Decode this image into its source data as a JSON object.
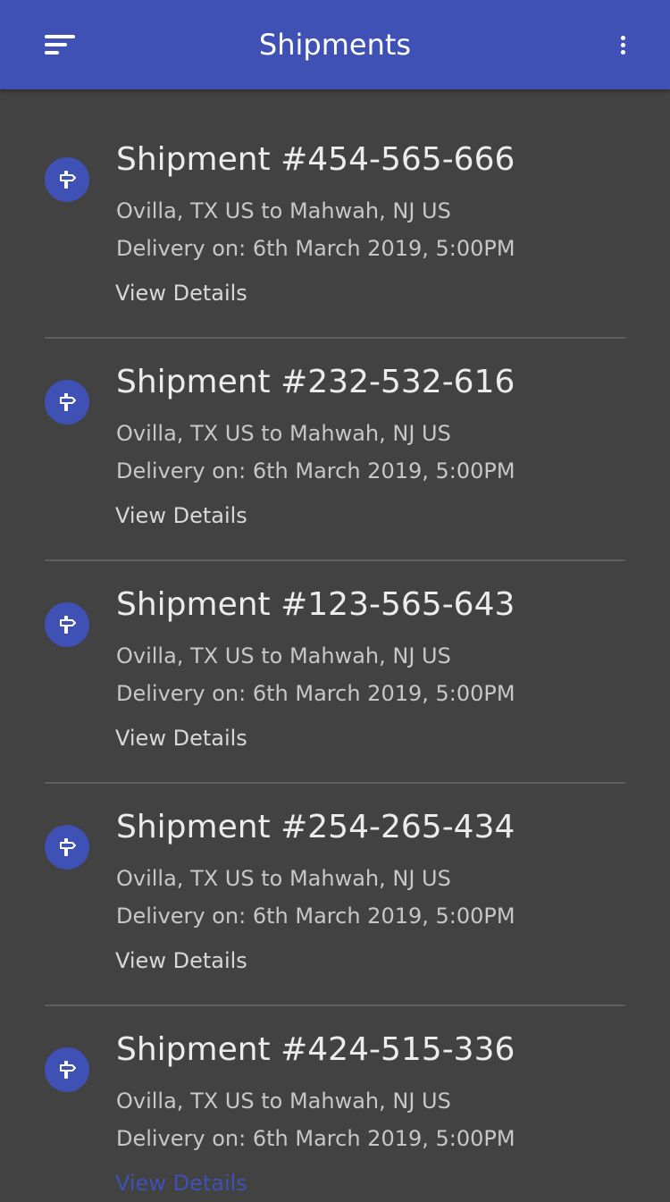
{
  "header": {
    "title": "Shipments",
    "menu_icon": "sort-menu-icon",
    "more_icon": "more-vert-icon",
    "color": "#3f51b5"
  },
  "shipments": [
    {
      "title": "Shipment #454-565-666",
      "route": "Ovilla, TX US to Mahwah, NJ US",
      "delivery": "Delivery on: 6th March 2019, 5:00PM",
      "link": "View Details",
      "icon": "signpost-icon"
    },
    {
      "title": "Shipment #232-532-616",
      "route": "Ovilla, TX US to Mahwah, NJ US",
      "delivery": "Delivery on: 6th March 2019, 5:00PM",
      "link": "View Details",
      "icon": "signpost-icon"
    },
    {
      "title": "Shipment #123-565-643",
      "route": "Ovilla, TX US to Mahwah, NJ US",
      "delivery": "Delivery on: 6th March 2019, 5:00PM",
      "link": "View Details",
      "icon": "signpost-icon"
    },
    {
      "title": "Shipment #254-265-434",
      "route": "Ovilla, TX US to Mahwah, NJ US",
      "delivery": "Delivery on: 6th March 2019, 5:00PM",
      "link": "View Details",
      "icon": "signpost-icon"
    },
    {
      "title": "Shipment #424-515-336",
      "route": "Ovilla, TX US to Mahwah, NJ US",
      "delivery": "Delivery on: 6th March 2019, 5:00PM",
      "link": "View Details",
      "icon": "signpost-icon"
    }
  ]
}
